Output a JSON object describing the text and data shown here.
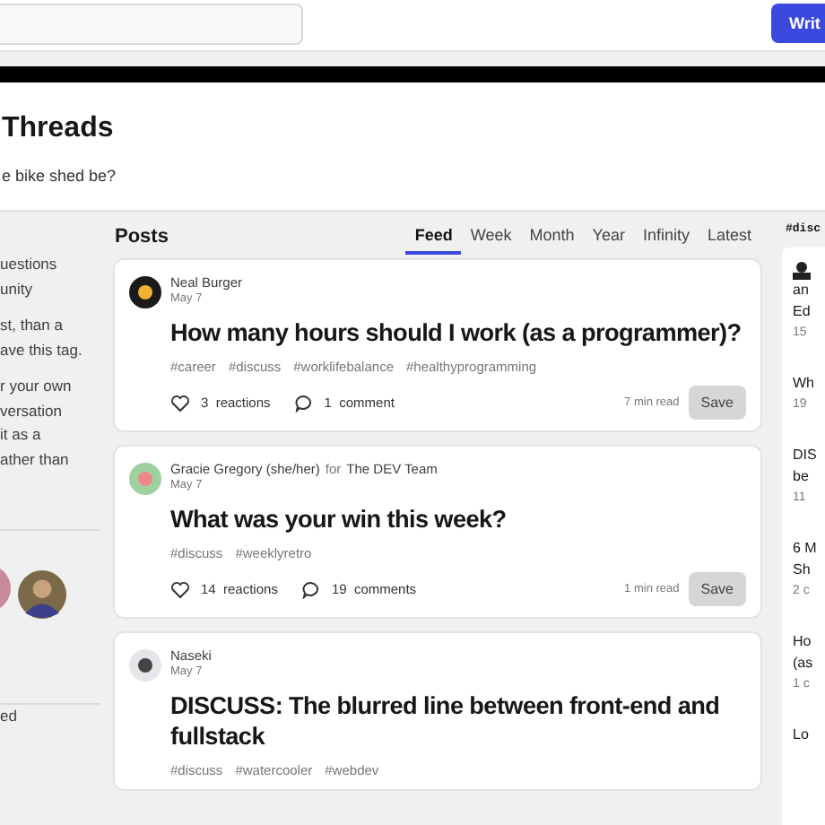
{
  "header": {
    "write_button": "Writ"
  },
  "page_header": {
    "title": "Threads",
    "subtitle": "e bike shed be?"
  },
  "left_sidebar": {
    "paragraphs": [
      [
        "uestions",
        "unity"
      ],
      [
        "st, than a",
        "ave this tag."
      ],
      [
        "r your own",
        "versation",
        "it as a",
        "ather than"
      ]
    ],
    "footer_text": "ed"
  },
  "posts": {
    "heading": "Posts",
    "tabs": [
      {
        "label": "Feed",
        "selected": true
      },
      {
        "label": "Week",
        "selected": false
      },
      {
        "label": "Month",
        "selected": false
      },
      {
        "label": "Year",
        "selected": false
      },
      {
        "label": "Infinity",
        "selected": false
      },
      {
        "label": "Latest",
        "selected": false
      }
    ],
    "articles": [
      {
        "author": "Neal Burger",
        "date": "May 7",
        "title": "How many hours should I work (as a programmer)?",
        "tags": [
          "#career",
          "#discuss",
          "#worklifebalance",
          "#healthyprogramming"
        ],
        "reactions_count": "3",
        "reactions_label": "reactions",
        "comments_count": "1",
        "comments_label": "comment",
        "read_time": "7 min read",
        "save": "Save"
      },
      {
        "author": "Gracie Gregory (she/her)",
        "for": "for",
        "org": "The DEV Team",
        "date": "May 7",
        "title": "What was your win this week?",
        "tags": [
          "#discuss",
          "#weeklyretro"
        ],
        "reactions_count": "14",
        "reactions_label": "reactions",
        "comments_count": "19",
        "comments_label": "comments",
        "read_time": "1 min read",
        "save": "Save"
      },
      {
        "author": "Naseki",
        "date": "May 7",
        "title": "DISCUSS: The blurred line between front-end and fullstack",
        "tags": [
          "#discuss",
          "#watercooler",
          "#webdev"
        ]
      }
    ]
  },
  "right_sidebar": {
    "heading": "#disc",
    "items": [
      {
        "lines": [
          "an",
          "Ed"
        ],
        "meta": "15"
      },
      {
        "lines": [
          "Wh"
        ],
        "meta": "19"
      },
      {
        "lines": [
          "DIS",
          "be"
        ],
        "meta": "11"
      },
      {
        "lines": [
          "6 M",
          "Sh"
        ],
        "meta": "2 c"
      },
      {
        "lines": [
          "Ho",
          "(as"
        ],
        "meta": "1 c"
      },
      {
        "lines": [
          "Lo"
        ]
      }
    ]
  }
}
